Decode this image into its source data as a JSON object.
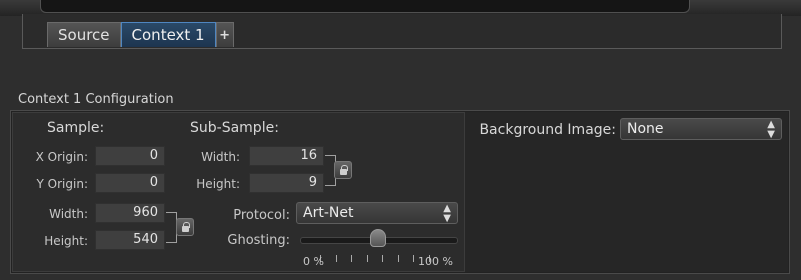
{
  "tabs": [
    {
      "label": "Source",
      "active": false
    },
    {
      "label": "Context 1",
      "active": true
    }
  ],
  "add_tab_symbol": "+",
  "section_title": "Context 1 Configuration",
  "sample": {
    "header": "Sample:",
    "x_origin_label": "X Origin:",
    "x_origin_value": "0",
    "y_origin_label": "Y Origin:",
    "y_origin_value": "0",
    "width_label": "Width:",
    "width_value": "960",
    "height_label": "Height:",
    "height_value": "540"
  },
  "subsample": {
    "header": "Sub-Sample:",
    "width_label": "Width:",
    "width_value": "16",
    "height_label": "Height:",
    "height_value": "9"
  },
  "protocol": {
    "label": "Protocol:",
    "value": "Art-Net"
  },
  "ghosting": {
    "label": "Ghosting:",
    "min_label": "0 %",
    "max_label": "100 %",
    "level": 0.5
  },
  "background_image": {
    "label": "Background Image:",
    "value": "None"
  },
  "icons": [
    "lock-icon",
    "add-icon",
    "updown-arrows-icon"
  ],
  "colors": {
    "accent": "#4f86c0",
    "background": "#2e2e2e"
  }
}
